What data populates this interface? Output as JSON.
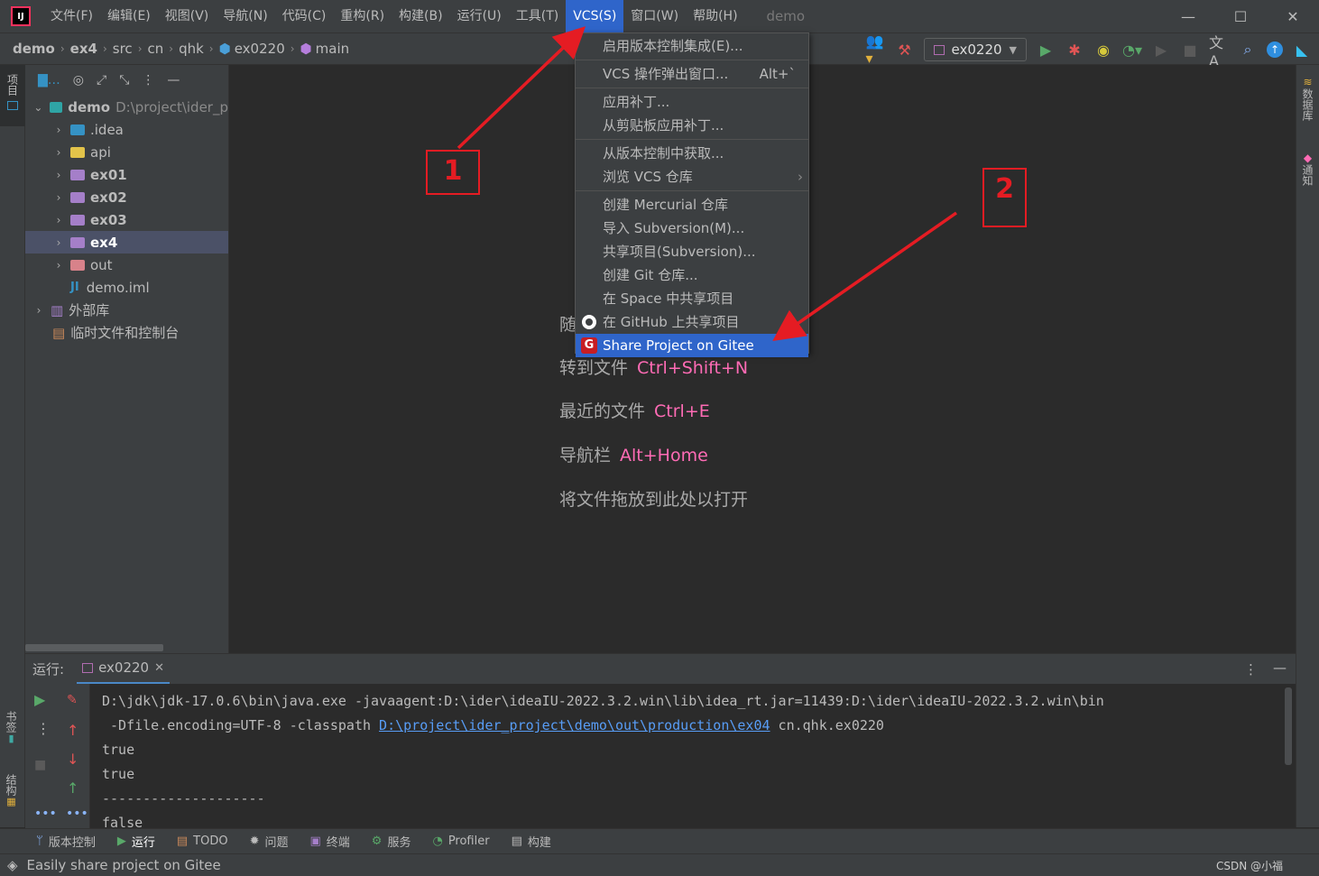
{
  "menubar": {
    "items": [
      "文件(F)",
      "编辑(E)",
      "视图(V)",
      "导航(N)",
      "代码(C)",
      "重构(R)",
      "构建(B)",
      "运行(U)",
      "工具(T)",
      "VCS(S)",
      "窗口(W)",
      "帮助(H)"
    ],
    "active": "VCS(S)",
    "title": "demo"
  },
  "breadcrumb": [
    "demo",
    "ex4",
    "src",
    "cn",
    "qhk",
    "ex0220",
    "main"
  ],
  "toolbar": {
    "run_config": "ex0220"
  },
  "project": {
    "root_name": "demo",
    "root_path": "D:\\project\\ider_p",
    "items": [
      ".idea",
      "api",
      "ex01",
      "ex02",
      "ex03",
      "ex4",
      "out",
      "demo.iml"
    ],
    "external": "外部库",
    "scratches": "临时文件和控制台"
  },
  "vcs_menu": {
    "enable": "启用版本控制集成(E)...",
    "popup": "VCS 操作弹出窗口...",
    "popup_shortcut": "Alt+`",
    "apply_patch": "应用补丁...",
    "apply_clipboard": "从剪贴板应用补丁...",
    "get_from_vcs": "从版本控制中获取...",
    "browse": "浏览 VCS 仓库",
    "mercurial": "创建 Mercurial 仓库",
    "svn_import": "导入 Subversion(M)...",
    "svn_share": "共享项目(Subversion)...",
    "git_create": "创建 Git 仓库...",
    "space": "在 Space 中共享项目",
    "github": "在 GitHub 上共享项目",
    "gitee": "Share Project on Gitee"
  },
  "editor_hints": [
    {
      "text": "随",
      "key": ""
    },
    {
      "text": "转到文件",
      "key": "Ctrl+Shift+N"
    },
    {
      "text": "最近的文件",
      "key": "Ctrl+E"
    },
    {
      "text": "导航栏",
      "key": "Alt+Home"
    },
    {
      "text": "将文件拖放到此处以打开",
      "key": ""
    }
  ],
  "annotations": {
    "one": "1",
    "two": "2"
  },
  "run": {
    "label": "运行:",
    "tab": "ex0220",
    "console": [
      "D:\\jdk\\jdk-17.0.6\\bin\\java.exe -javaagent:D:\\ider\\ideaIU-2022.3.2.win\\lib\\idea_rt.jar=11439:D:\\ider\\ideaIU-2022.3.2.win\\bin",
      " -Dfile.encoding=UTF-8 -classpath ",
      "D:\\project\\ider_project\\demo\\out\\production\\ex04",
      " cn.qhk.ex0220",
      "true",
      "true",
      "--------------------",
      "false"
    ]
  },
  "bottom_tabs": [
    "版本控制",
    "运行",
    "TODO",
    "问题",
    "终端",
    "服务",
    "Profiler",
    "构建"
  ],
  "side": {
    "left_top": "项目",
    "left_bottom1": "书签",
    "left_bottom2": "结构",
    "right1": "数据库",
    "right2": "通知"
  },
  "status": "Easily share project on Gitee",
  "watermark": "CSDN @小福",
  "colors": {
    "accent": "#2f65ca",
    "annotation": "#e51c23",
    "shortcut": "#ff6bb5"
  }
}
